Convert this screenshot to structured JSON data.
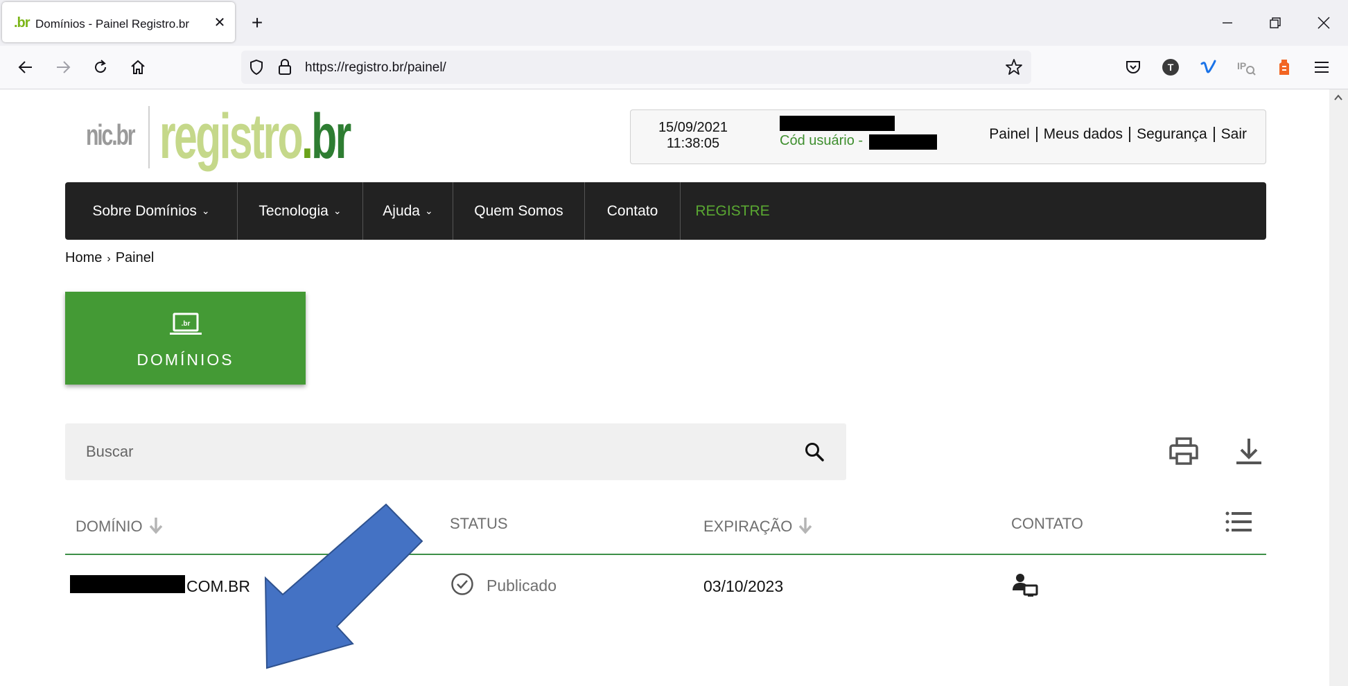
{
  "browser": {
    "tab_title": "Domínios - Painel Registro.br",
    "tab_favicon": ".br",
    "url": "https://registro.br/painel/",
    "icons": [
      "back-icon",
      "forward-icon",
      "reload-icon",
      "home-icon",
      "shield-icon",
      "lock-icon",
      "star-icon",
      "pocket-icon",
      "account-icon",
      "vimeo-icon",
      "ip-icon",
      "extension-icon",
      "menu-icon"
    ]
  },
  "logo": {
    "nic": "nic.br",
    "main_reg": "registro",
    "main_dot": ".",
    "main_br": "br"
  },
  "userbox": {
    "date": "15/09/2021",
    "time": "11:38:05",
    "code_label": "Cód usuário -",
    "links": [
      "Painel",
      "Meus dados",
      "Segurança",
      "Sair"
    ]
  },
  "mainnav": {
    "items": [
      {
        "label": "Sobre Domínios",
        "dropdown": "⌄"
      },
      {
        "label": "Tecnologia",
        "dropdown": "⌄"
      },
      {
        "label": "Ajuda",
        "dropdown": "⌄"
      },
      {
        "label": "Quem Somos"
      },
      {
        "label": "Contato"
      },
      {
        "label": "REGISTRE"
      }
    ]
  },
  "breadcrumb": {
    "home": "Home",
    "separator": "›",
    "current": "Painel"
  },
  "card": {
    "label": "DOMÍNIOS",
    "icon": "laptop-br-icon"
  },
  "search": {
    "placeholder": "Buscar"
  },
  "table": {
    "headers": [
      "DOMÍNIO",
      "STATUS",
      "EXPIRAÇÃO",
      "CONTATO"
    ],
    "rows": [
      {
        "domain_suffix": "COM.BR",
        "status": "Publicado",
        "expiration": "03/10/2023"
      }
    ]
  },
  "colors": {
    "brand_green": "#449a35",
    "nav_dark": "#222222",
    "accent_green": "#5aa832",
    "arrow_blue": "#4472c4"
  }
}
